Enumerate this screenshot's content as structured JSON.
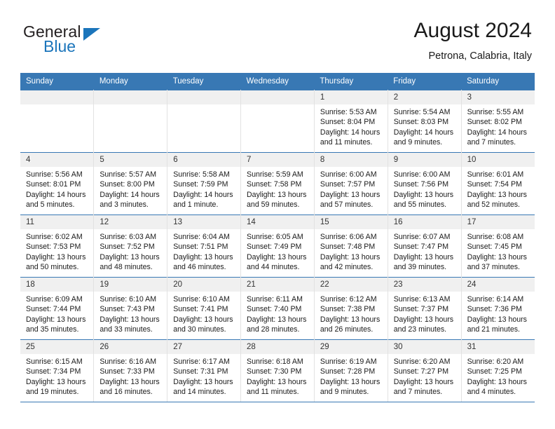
{
  "brand": {
    "name_top": "General",
    "name_bottom": "Blue",
    "accent_color": "#1b75bb"
  },
  "header": {
    "title": "August 2024",
    "subtitle": "Petrona, Calabria, Italy"
  },
  "theme": {
    "header_row_bg": "#3878b4",
    "daynum_bg": "#f0f0f0",
    "grid_line": "#3878b4",
    "text": "#1a1a1a"
  },
  "labels": {
    "sunrise_prefix": "Sunrise:",
    "sunset_prefix": "Sunset:",
    "daylight_prefix": "Daylight:"
  },
  "weekdays": [
    "Sunday",
    "Monday",
    "Tuesday",
    "Wednesday",
    "Thursday",
    "Friday",
    "Saturday"
  ],
  "weeks": [
    [
      {
        "day": "",
        "empty": true
      },
      {
        "day": "",
        "empty": true
      },
      {
        "day": "",
        "empty": true
      },
      {
        "day": "",
        "empty": true
      },
      {
        "day": "1",
        "sunrise": "Sunrise: 5:53 AM",
        "sunset": "Sunset: 8:04 PM",
        "daylight1": "Daylight: 14 hours",
        "daylight2": "and 11 minutes."
      },
      {
        "day": "2",
        "sunrise": "Sunrise: 5:54 AM",
        "sunset": "Sunset: 8:03 PM",
        "daylight1": "Daylight: 14 hours",
        "daylight2": "and 9 minutes."
      },
      {
        "day": "3",
        "sunrise": "Sunrise: 5:55 AM",
        "sunset": "Sunset: 8:02 PM",
        "daylight1": "Daylight: 14 hours",
        "daylight2": "and 7 minutes."
      }
    ],
    [
      {
        "day": "4",
        "sunrise": "Sunrise: 5:56 AM",
        "sunset": "Sunset: 8:01 PM",
        "daylight1": "Daylight: 14 hours",
        "daylight2": "and 5 minutes."
      },
      {
        "day": "5",
        "sunrise": "Sunrise: 5:57 AM",
        "sunset": "Sunset: 8:00 PM",
        "daylight1": "Daylight: 14 hours",
        "daylight2": "and 3 minutes."
      },
      {
        "day": "6",
        "sunrise": "Sunrise: 5:58 AM",
        "sunset": "Sunset: 7:59 PM",
        "daylight1": "Daylight: 14 hours",
        "daylight2": "and 1 minute."
      },
      {
        "day": "7",
        "sunrise": "Sunrise: 5:59 AM",
        "sunset": "Sunset: 7:58 PM",
        "daylight1": "Daylight: 13 hours",
        "daylight2": "and 59 minutes."
      },
      {
        "day": "8",
        "sunrise": "Sunrise: 6:00 AM",
        "sunset": "Sunset: 7:57 PM",
        "daylight1": "Daylight: 13 hours",
        "daylight2": "and 57 minutes."
      },
      {
        "day": "9",
        "sunrise": "Sunrise: 6:00 AM",
        "sunset": "Sunset: 7:56 PM",
        "daylight1": "Daylight: 13 hours",
        "daylight2": "and 55 minutes."
      },
      {
        "day": "10",
        "sunrise": "Sunrise: 6:01 AM",
        "sunset": "Sunset: 7:54 PM",
        "daylight1": "Daylight: 13 hours",
        "daylight2": "and 52 minutes."
      }
    ],
    [
      {
        "day": "11",
        "sunrise": "Sunrise: 6:02 AM",
        "sunset": "Sunset: 7:53 PM",
        "daylight1": "Daylight: 13 hours",
        "daylight2": "and 50 minutes."
      },
      {
        "day": "12",
        "sunrise": "Sunrise: 6:03 AM",
        "sunset": "Sunset: 7:52 PM",
        "daylight1": "Daylight: 13 hours",
        "daylight2": "and 48 minutes."
      },
      {
        "day": "13",
        "sunrise": "Sunrise: 6:04 AM",
        "sunset": "Sunset: 7:51 PM",
        "daylight1": "Daylight: 13 hours",
        "daylight2": "and 46 minutes."
      },
      {
        "day": "14",
        "sunrise": "Sunrise: 6:05 AM",
        "sunset": "Sunset: 7:49 PM",
        "daylight1": "Daylight: 13 hours",
        "daylight2": "and 44 minutes."
      },
      {
        "day": "15",
        "sunrise": "Sunrise: 6:06 AM",
        "sunset": "Sunset: 7:48 PM",
        "daylight1": "Daylight: 13 hours",
        "daylight2": "and 42 minutes."
      },
      {
        "day": "16",
        "sunrise": "Sunrise: 6:07 AM",
        "sunset": "Sunset: 7:47 PM",
        "daylight1": "Daylight: 13 hours",
        "daylight2": "and 39 minutes."
      },
      {
        "day": "17",
        "sunrise": "Sunrise: 6:08 AM",
        "sunset": "Sunset: 7:45 PM",
        "daylight1": "Daylight: 13 hours",
        "daylight2": "and 37 minutes."
      }
    ],
    [
      {
        "day": "18",
        "sunrise": "Sunrise: 6:09 AM",
        "sunset": "Sunset: 7:44 PM",
        "daylight1": "Daylight: 13 hours",
        "daylight2": "and 35 minutes."
      },
      {
        "day": "19",
        "sunrise": "Sunrise: 6:10 AM",
        "sunset": "Sunset: 7:43 PM",
        "daylight1": "Daylight: 13 hours",
        "daylight2": "and 33 minutes."
      },
      {
        "day": "20",
        "sunrise": "Sunrise: 6:10 AM",
        "sunset": "Sunset: 7:41 PM",
        "daylight1": "Daylight: 13 hours",
        "daylight2": "and 30 minutes."
      },
      {
        "day": "21",
        "sunrise": "Sunrise: 6:11 AM",
        "sunset": "Sunset: 7:40 PM",
        "daylight1": "Daylight: 13 hours",
        "daylight2": "and 28 minutes."
      },
      {
        "day": "22",
        "sunrise": "Sunrise: 6:12 AM",
        "sunset": "Sunset: 7:38 PM",
        "daylight1": "Daylight: 13 hours",
        "daylight2": "and 26 minutes."
      },
      {
        "day": "23",
        "sunrise": "Sunrise: 6:13 AM",
        "sunset": "Sunset: 7:37 PM",
        "daylight1": "Daylight: 13 hours",
        "daylight2": "and 23 minutes."
      },
      {
        "day": "24",
        "sunrise": "Sunrise: 6:14 AM",
        "sunset": "Sunset: 7:36 PM",
        "daylight1": "Daylight: 13 hours",
        "daylight2": "and 21 minutes."
      }
    ],
    [
      {
        "day": "25",
        "sunrise": "Sunrise: 6:15 AM",
        "sunset": "Sunset: 7:34 PM",
        "daylight1": "Daylight: 13 hours",
        "daylight2": "and 19 minutes."
      },
      {
        "day": "26",
        "sunrise": "Sunrise: 6:16 AM",
        "sunset": "Sunset: 7:33 PM",
        "daylight1": "Daylight: 13 hours",
        "daylight2": "and 16 minutes."
      },
      {
        "day": "27",
        "sunrise": "Sunrise: 6:17 AM",
        "sunset": "Sunset: 7:31 PM",
        "daylight1": "Daylight: 13 hours",
        "daylight2": "and 14 minutes."
      },
      {
        "day": "28",
        "sunrise": "Sunrise: 6:18 AM",
        "sunset": "Sunset: 7:30 PM",
        "daylight1": "Daylight: 13 hours",
        "daylight2": "and 11 minutes."
      },
      {
        "day": "29",
        "sunrise": "Sunrise: 6:19 AM",
        "sunset": "Sunset: 7:28 PM",
        "daylight1": "Daylight: 13 hours",
        "daylight2": "and 9 minutes."
      },
      {
        "day": "30",
        "sunrise": "Sunrise: 6:20 AM",
        "sunset": "Sunset: 7:27 PM",
        "daylight1": "Daylight: 13 hours",
        "daylight2": "and 7 minutes."
      },
      {
        "day": "31",
        "sunrise": "Sunrise: 6:20 AM",
        "sunset": "Sunset: 7:25 PM",
        "daylight1": "Daylight: 13 hours",
        "daylight2": "and 4 minutes."
      }
    ]
  ]
}
